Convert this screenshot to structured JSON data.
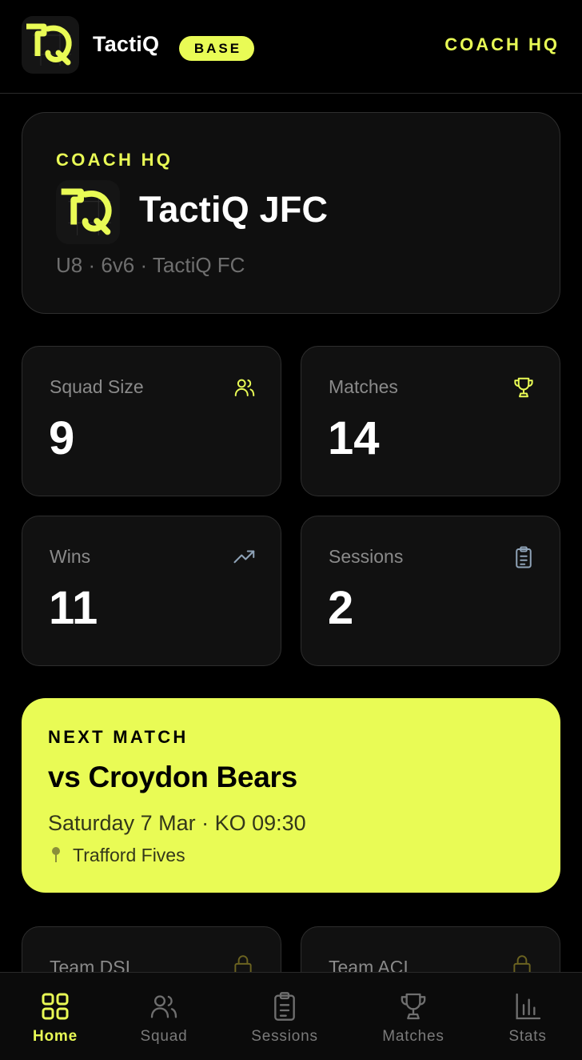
{
  "app": {
    "name": "TactiQ",
    "plan_badge": "BASE",
    "header_link": "COACH HQ"
  },
  "club": {
    "eyebrow": "COACH HQ",
    "name": "TactiQ JFC",
    "meta": "U8 · 6v6 · TactiQ FC"
  },
  "stats": [
    {
      "label": "Squad Size",
      "value": "9",
      "icon": "users-icon"
    },
    {
      "label": "Matches",
      "value": "14",
      "icon": "trophy-icon"
    },
    {
      "label": "Wins",
      "value": "11",
      "icon": "trending-up-icon"
    },
    {
      "label": "Sessions",
      "value": "2",
      "icon": "clipboard-icon"
    }
  ],
  "next_match": {
    "eyebrow": "NEXT MATCH",
    "title": "vs Croydon Bears",
    "datetime": "Saturday 7 Mar · KO 09:30",
    "venue": "Trafford Fives"
  },
  "locked": [
    {
      "label": "Team DSI",
      "icon": "lock-icon"
    },
    {
      "label": "Team ACI",
      "icon": "lock-icon"
    }
  ],
  "nav": [
    {
      "label": "Home",
      "icon": "home-grid-icon",
      "active": true
    },
    {
      "label": "Squad",
      "icon": "users-icon",
      "active": false
    },
    {
      "label": "Sessions",
      "icon": "clipboard-icon",
      "active": false
    },
    {
      "label": "Matches",
      "icon": "trophy-icon",
      "active": false
    },
    {
      "label": "Stats",
      "icon": "bar-chart-icon",
      "active": false
    }
  ],
  "colors": {
    "accent": "#e9fb55",
    "background": "#000000",
    "card": "#111111",
    "muted_text": "#8a8a8a"
  }
}
